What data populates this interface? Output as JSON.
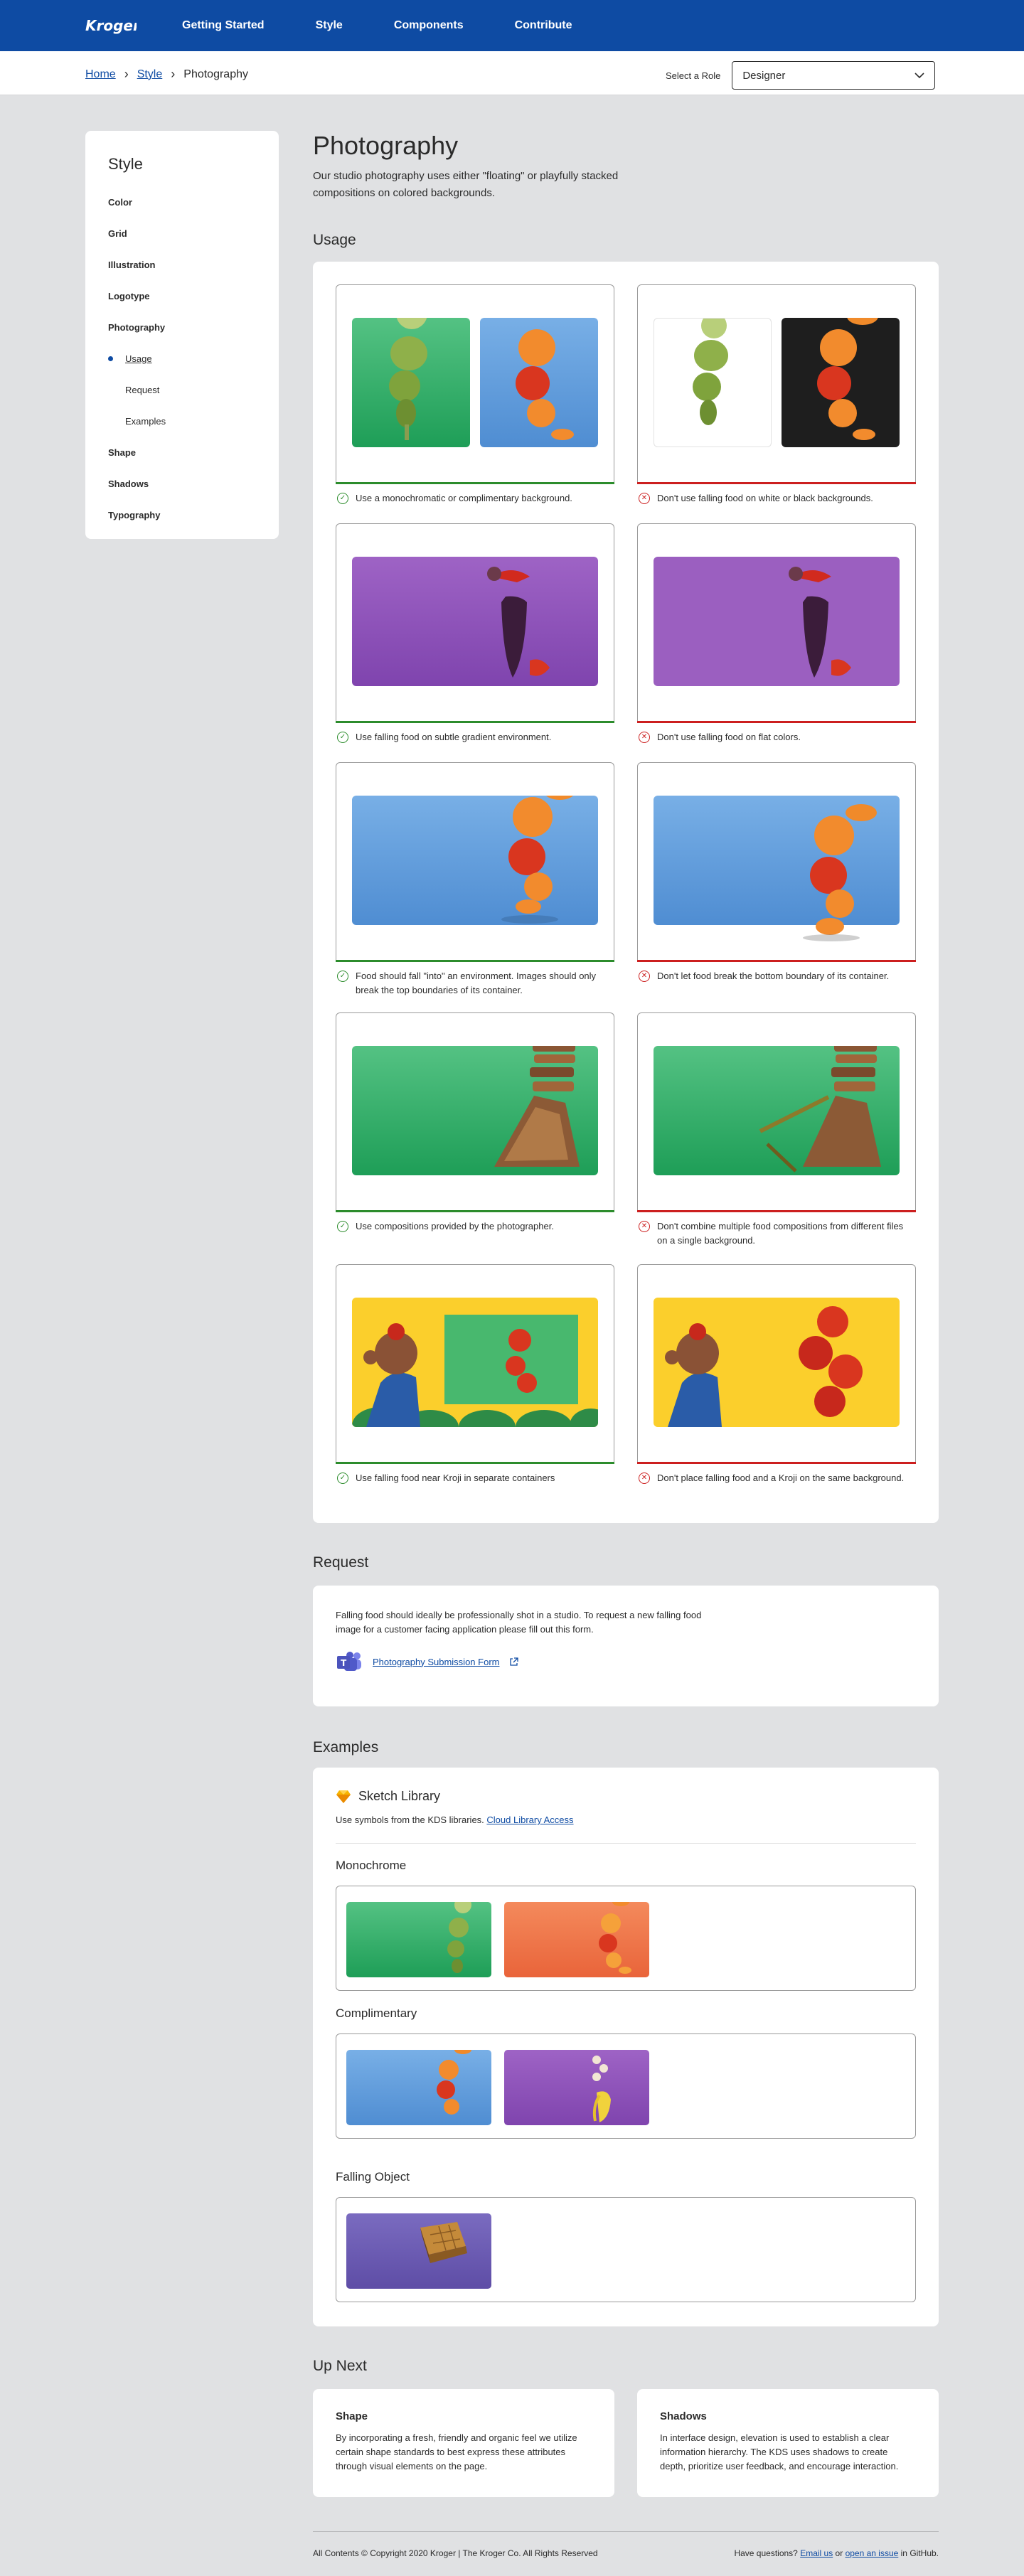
{
  "header": {
    "logo_text": "Kroger",
    "nav": [
      "Getting Started",
      "Style",
      "Components",
      "Contribute"
    ]
  },
  "breadcrumb": {
    "home": "Home",
    "style": "Style",
    "current": "Photography"
  },
  "role": {
    "label": "Select a Role",
    "value": "Designer"
  },
  "sidebar": {
    "title": "Style",
    "items": [
      "Color",
      "Grid",
      "Illustration",
      "Logotype",
      "Photography"
    ],
    "subitems": [
      "Usage",
      "Request",
      "Examples"
    ],
    "items_after": [
      "Shape",
      "Shadows",
      "Typography"
    ]
  },
  "page": {
    "title": "Photography",
    "intro": "Our studio photography uses either \"floating\" or playfully stacked compositions on colored backgrounds."
  },
  "usage": {
    "heading": "Usage",
    "rows": [
      {
        "do": "Use a monochromatic or complimentary background.",
        "dont": "Don't use falling food on white or black backgrounds."
      },
      {
        "do": "Use falling food on subtle gradient environment.",
        "dont": "Don't use falling food on flat colors."
      },
      {
        "do": "Food should fall \"into\" an environment. Images should only break the top boundaries of its container.",
        "dont": "Don't let food break the bottom boundary of its container."
      },
      {
        "do": "Use compositions provided by the photographer.",
        "dont": "Don't combine multiple food compositions from different files on a single background."
      },
      {
        "do": "Use falling food near Kroji in separate containers",
        "dont": "Don't place falling food and a Kroji on the same background."
      }
    ]
  },
  "request": {
    "heading": "Request",
    "text": "Falling food should ideally be professionally shot in a studio. To request a new falling food image for a customer facing application please fill out this form.",
    "link": "Photography Submission Form"
  },
  "examples": {
    "heading": "Examples",
    "library_title": "Sketch Library",
    "library_text": "Use symbols from the KDS libraries.",
    "library_link": "Cloud Library Access",
    "groups": [
      "Monochrome",
      "Complimentary",
      "Falling Object"
    ]
  },
  "up_next": {
    "heading": "Up Next",
    "cards": [
      {
        "title": "Shape",
        "text": "By incorporating a fresh, friendly and organic feel we utilize certain shape standards to best express these attributes through visual elements on the page."
      },
      {
        "title": "Shadows",
        "text": "In interface design, elevation is used to establish a clear information hierarchy. The KDS uses shadows to create depth, prioritize user feedback, and encourage interaction."
      }
    ]
  },
  "footer": {
    "copyright": "All Contents © Copyright 2020 Kroger | The Kroger Co. All Rights Reserved",
    "questions": "Have questions?",
    "email": "Email us",
    "or": "or",
    "issue": "open an issue",
    "tail": "in GitHub."
  },
  "colors": {
    "brand_blue": "#0E4BA3",
    "do_green": "#2C8C2C",
    "dont_red": "#CC1F1F"
  }
}
